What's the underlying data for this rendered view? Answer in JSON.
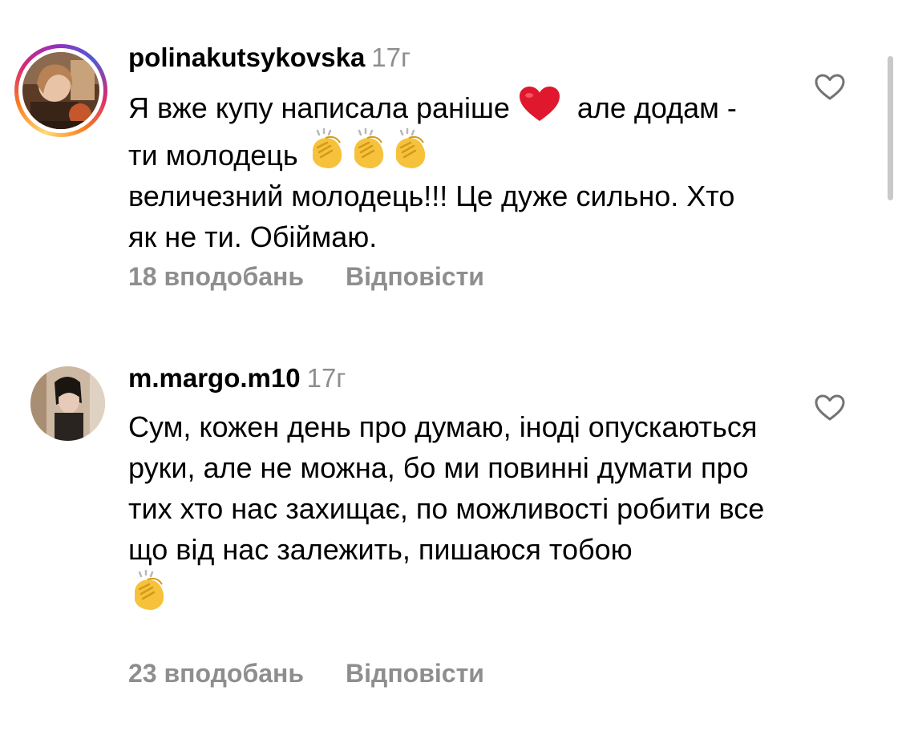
{
  "comments": [
    {
      "username": "polinakutsykovska",
      "time": "17г",
      "text_part1": "Я вже купу написала раніше ",
      "text_part2": "  але додам - ти молодець ",
      "text_part3": "величезний молодець!!! Це дуже сильно. Хто як не ти. Обіймаю.",
      "likes": "18 вподобань",
      "reply": "Відповісти",
      "has_story_ring": true,
      "emojis": [
        "red-heart",
        "clapping-hands",
        "clapping-hands",
        "clapping-hands"
      ]
    },
    {
      "username": "m.margo.m10",
      "time": "17г",
      "text": "Сум, кожен день про думаю, іноді опускаються руки, але не можна, бо ми повинні думати про тих хто нас захищає, по можливості робити все що від нас залежить, пишаюся тобою",
      "likes": "23 вподобань",
      "reply": "Відповісти",
      "has_story_ring": false,
      "emojis": [
        "clapping-hands"
      ]
    }
  ],
  "colors": {
    "text": "#000000",
    "secondary": "#8e8e8e",
    "heart_emoji": "#e0182d",
    "clap_emoji": "#f7c23b",
    "scrollbar": "#c9c9c9"
  }
}
